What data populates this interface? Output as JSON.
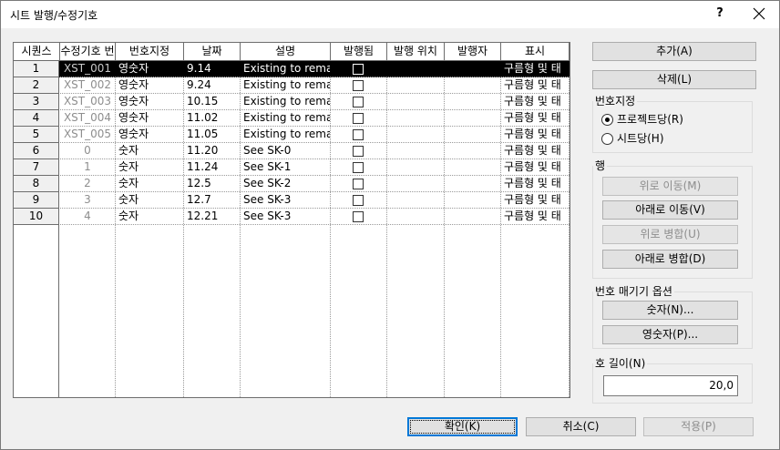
{
  "window": {
    "title": "시트 발행/수정기호",
    "help": "?",
    "close_icon": "close-icon"
  },
  "grid": {
    "columns": [
      "시퀀스",
      "수정기호 번",
      "번호지정",
      "날짜",
      "설명",
      "발행됨",
      "발행 위치",
      "발행자",
      "표시"
    ],
    "rows": [
      {
        "seq": "1",
        "rev": "XST_001",
        "numbering": "영숫자",
        "date": "9.14",
        "desc": "Existing to remai",
        "issued": false,
        "issued_to": "",
        "issued_by": "",
        "show": "구름형 및 태"
      },
      {
        "seq": "2",
        "rev": "XST_002",
        "numbering": "영숫자",
        "date": "9.24",
        "desc": "Existing to remai",
        "issued": false,
        "issued_to": "",
        "issued_by": "",
        "show": "구름형 및 태"
      },
      {
        "seq": "3",
        "rev": "XST_003",
        "numbering": "영숫자",
        "date": "10.15",
        "desc": "Existing to remai",
        "issued": false,
        "issued_to": "",
        "issued_by": "",
        "show": "구름형 및 태"
      },
      {
        "seq": "4",
        "rev": "XST_004",
        "numbering": "영숫자",
        "date": "11.02",
        "desc": "Existing to remai",
        "issued": false,
        "issued_to": "",
        "issued_by": "",
        "show": "구름형 및 태"
      },
      {
        "seq": "5",
        "rev": "XST_005",
        "numbering": "영숫자",
        "date": "11.05",
        "desc": "Existing to remai",
        "issued": false,
        "issued_to": "",
        "issued_by": "",
        "show": "구름형 및 태"
      },
      {
        "seq": "6",
        "rev": "0",
        "numbering": "숫자",
        "date": "11.20",
        "desc": "See SK-0",
        "issued": false,
        "issued_to": "",
        "issued_by": "",
        "show": "구름형 및 태"
      },
      {
        "seq": "7",
        "rev": "1",
        "numbering": "숫자",
        "date": "11.24",
        "desc": "See SK-1",
        "issued": false,
        "issued_to": "",
        "issued_by": "",
        "show": "구름형 및 태"
      },
      {
        "seq": "8",
        "rev": "2",
        "numbering": "숫자",
        "date": "12.5",
        "desc": "See SK-2",
        "issued": false,
        "issued_to": "",
        "issued_by": "",
        "show": "구름형 및 태"
      },
      {
        "seq": "9",
        "rev": "3",
        "numbering": "숫자",
        "date": "12.7",
        "desc": "See SK-3",
        "issued": false,
        "issued_to": "",
        "issued_by": "",
        "show": "구름형 및 태"
      },
      {
        "seq": "10",
        "rev": "4",
        "numbering": "숫자",
        "date": "12.21",
        "desc": "See SK-3",
        "issued": false,
        "issued_to": "",
        "issued_by": "",
        "show": "구름형 및 태"
      }
    ],
    "selected_row": 0
  },
  "buttons": {
    "add": "추가(A)",
    "delete": "삭제(L)",
    "move_up": "위로 이동(M)",
    "move_down": "아래로 이동(V)",
    "merge_up": "위로 병합(U)",
    "merge_down": "아래로 병합(D)",
    "numeric": "숫자(N)...",
    "alphanumeric": "영숫자(P)...",
    "ok": "확인(K)",
    "cancel": "취소(C)",
    "apply": "적용(P)"
  },
  "numbering_group": {
    "title": "번호지정",
    "options": [
      "프로젝트당(R)",
      "시트당(H)"
    ],
    "selected": 0
  },
  "row_group": {
    "title": "행"
  },
  "options_group": {
    "title": "번호 매기기 옵션"
  },
  "arc_group": {
    "title": "호 길이(N)",
    "value": "20,0"
  },
  "colors": {
    "selection": "#000000",
    "disabled_text": "#8d8d8d",
    "focus_border": "#0078d7"
  }
}
